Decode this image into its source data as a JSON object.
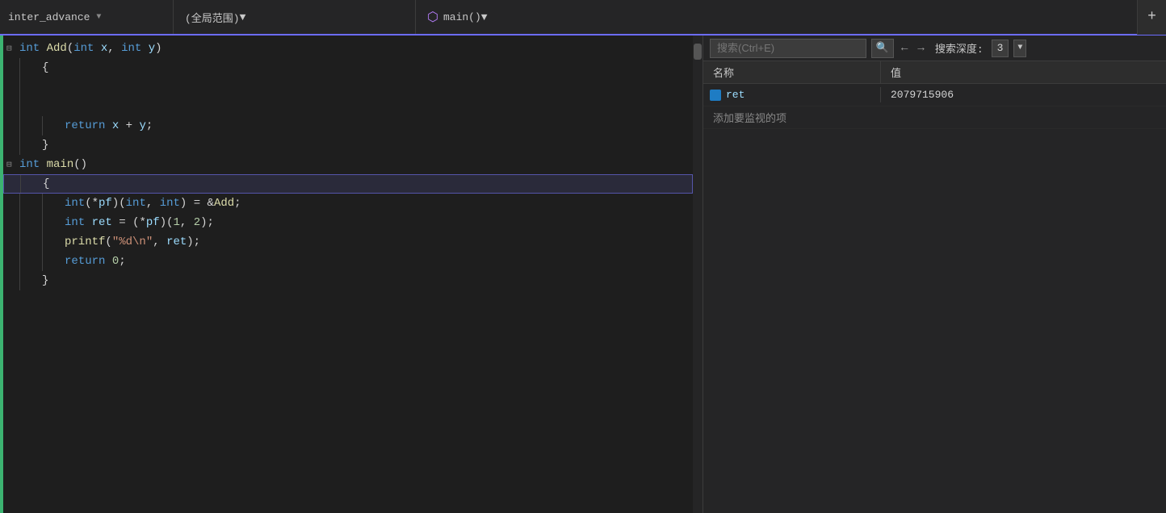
{
  "toolbar": {
    "file_label": "inter_advance",
    "scope_label": "(全局范围)",
    "func_icon": "⬡",
    "func_label": "main()",
    "expand_label": "+"
  },
  "code": {
    "lines": [
      {
        "id": 1,
        "indent": 0,
        "collapse": "⊟",
        "tokens": [
          {
            "type": "kw",
            "text": "int"
          },
          {
            "type": "plain",
            "text": " "
          },
          {
            "type": "fn",
            "text": "Add"
          },
          {
            "type": "pn",
            "text": "("
          },
          {
            "type": "kw",
            "text": "int"
          },
          {
            "type": "plain",
            "text": " "
          },
          {
            "type": "param",
            "text": "x"
          },
          {
            "type": "pn",
            "text": ", "
          },
          {
            "type": "kw",
            "text": "int"
          },
          {
            "type": "plain",
            "text": " "
          },
          {
            "type": "param",
            "text": "y"
          },
          {
            "type": "pn",
            "text": ")"
          }
        ]
      },
      {
        "id": 2,
        "indent": 1,
        "collapse": "",
        "tokens": [
          {
            "type": "pn",
            "text": "{"
          }
        ]
      },
      {
        "id": 3,
        "indent": 1,
        "collapse": "",
        "tokens": []
      },
      {
        "id": 4,
        "indent": 1,
        "collapse": "",
        "tokens": []
      },
      {
        "id": 5,
        "indent": 2,
        "collapse": "",
        "tokens": [
          {
            "type": "kw",
            "text": "return"
          },
          {
            "type": "plain",
            "text": " "
          },
          {
            "type": "param",
            "text": "x"
          },
          {
            "type": "plain",
            "text": " "
          },
          {
            "type": "op",
            "text": "+"
          },
          {
            "type": "plain",
            "text": " "
          },
          {
            "type": "param",
            "text": "y"
          },
          {
            "type": "pn",
            "text": ";"
          }
        ]
      },
      {
        "id": 6,
        "indent": 1,
        "collapse": "",
        "tokens": [
          {
            "type": "pn",
            "text": "}"
          }
        ]
      },
      {
        "id": 7,
        "indent": 0,
        "collapse": "⊟",
        "tokens": [
          {
            "type": "kw",
            "text": "int"
          },
          {
            "type": "plain",
            "text": " "
          },
          {
            "type": "fn",
            "text": "main"
          },
          {
            "type": "pn",
            "text": "()"
          }
        ]
      },
      {
        "id": 8,
        "indent": 1,
        "collapse": "",
        "highlight": true,
        "tokens": [
          {
            "type": "pn",
            "text": "{"
          }
        ]
      },
      {
        "id": 9,
        "indent": 2,
        "collapse": "",
        "tokens": [
          {
            "type": "kw",
            "text": "int"
          },
          {
            "type": "pn",
            "text": "("
          },
          {
            "type": "op",
            "text": "*"
          },
          {
            "type": "var",
            "text": "pf"
          },
          {
            "type": "pn",
            "text": ")("
          },
          {
            "type": "kw",
            "text": "int"
          },
          {
            "type": "pn",
            "text": ", "
          },
          {
            "type": "kw",
            "text": "int"
          },
          {
            "type": "pn",
            "text": ") "
          },
          {
            "type": "op",
            "text": "="
          },
          {
            "type": "plain",
            "text": " "
          },
          {
            "type": "op",
            "text": "&"
          },
          {
            "type": "fn",
            "text": "Add"
          },
          {
            "type": "pn",
            "text": ";"
          }
        ]
      },
      {
        "id": 10,
        "indent": 2,
        "collapse": "",
        "tokens": [
          {
            "type": "kw",
            "text": "int"
          },
          {
            "type": "plain",
            "text": " "
          },
          {
            "type": "var",
            "text": "ret"
          },
          {
            "type": "plain",
            "text": " "
          },
          {
            "type": "op",
            "text": "="
          },
          {
            "type": "plain",
            "text": " "
          },
          {
            "type": "pn",
            "text": "("
          },
          {
            "type": "op",
            "text": "*"
          },
          {
            "type": "var",
            "text": "pf"
          },
          {
            "type": "pn",
            "text": ")("
          },
          {
            "type": "num",
            "text": "1"
          },
          {
            "type": "pn",
            "text": ", "
          },
          {
            "type": "num",
            "text": "2"
          },
          {
            "type": "pn",
            "text": ");"
          }
        ]
      },
      {
        "id": 11,
        "indent": 2,
        "collapse": "",
        "tokens": [
          {
            "type": "macro",
            "text": "printf"
          },
          {
            "type": "pn",
            "text": "("
          },
          {
            "type": "str",
            "text": "\"%d\\n\""
          },
          {
            "type": "pn",
            "text": ", "
          },
          {
            "type": "var",
            "text": "ret"
          },
          {
            "type": "pn",
            "text": ");"
          }
        ]
      },
      {
        "id": 12,
        "indent": 2,
        "collapse": "",
        "tokens": [
          {
            "type": "kw",
            "text": "return"
          },
          {
            "type": "plain",
            "text": " "
          },
          {
            "type": "num",
            "text": "0"
          },
          {
            "type": "pn",
            "text": ";"
          }
        ]
      },
      {
        "id": 13,
        "indent": 1,
        "collapse": "",
        "tokens": [
          {
            "type": "pn",
            "text": "}"
          }
        ]
      }
    ]
  },
  "watch": {
    "search_placeholder": "搜索(Ctrl+E)",
    "depth_label": "搜索深度:",
    "depth_value": "3",
    "col_name": "名称",
    "col_val": "值",
    "rows": [
      {
        "name": "ret",
        "value": "2079715906"
      }
    ],
    "add_label": "添加要监视的项"
  }
}
